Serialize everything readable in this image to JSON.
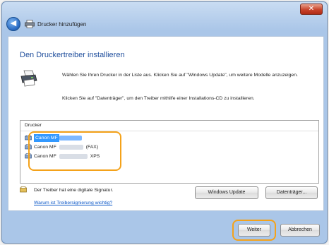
{
  "window": {
    "close_glyph": "✕"
  },
  "titlebar": {
    "back_glyph": "◀",
    "title": "Drucker hinzufügen"
  },
  "content": {
    "heading": "Den Druckertreiber installieren",
    "description_line1": "Wählen Sie Ihren Drucker in der Liste aus. Klicken Sie auf \"Windows Update\", um weitere Modelle anzuzeigen.",
    "description_line2": "Klicken Sie auf \"Datenträger\", um den Treiber mithilfe einer Installations-CD zu installieren."
  },
  "printer_list": {
    "header": "Drucker",
    "items": [
      {
        "name": "Canon MF",
        "suffix": "",
        "selected": true
      },
      {
        "name": "Canon MF",
        "suffix": "(FAX)",
        "selected": false
      },
      {
        "name": "Canon MF",
        "suffix": "XPS",
        "selected": false
      }
    ]
  },
  "signature": {
    "text": "Der Treiber hat eine digitale Signatur.",
    "link": "Warum ist Treibersignierung wichtig?"
  },
  "buttons": {
    "windows_update": "Windows Update",
    "disk": "Datenträger...",
    "next": "Weiter",
    "cancel": "Abbrechen"
  },
  "colors": {
    "highlight_ring": "#f4a21a",
    "selection": "#3399ff",
    "heading": "#1f4e9c"
  }
}
